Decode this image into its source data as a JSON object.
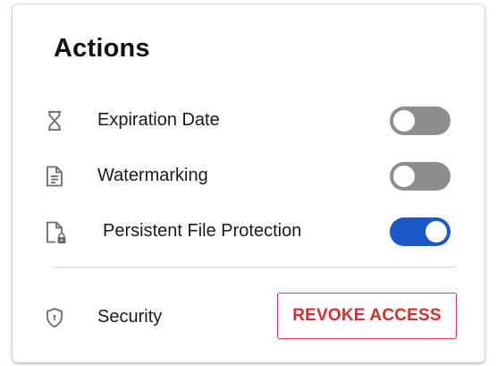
{
  "panel": {
    "title": "Actions"
  },
  "actions": [
    {
      "label": "Expiration Date",
      "icon": "hourglass-icon",
      "enabled": false
    },
    {
      "label": "Watermarking",
      "icon": "document-icon",
      "enabled": false
    },
    {
      "label": "Persistent File Protection",
      "icon": "locked-file-icon",
      "enabled": true
    }
  ],
  "security": {
    "label": "Security",
    "icon": "shield-icon",
    "revoke_label": "REVOKE ACCESS"
  },
  "colors": {
    "toggle_on": "#1b58c8",
    "toggle_off": "#8e8e8e",
    "revoke_accent": "#d32f2f",
    "icon_gray": "#6b6b6b"
  }
}
